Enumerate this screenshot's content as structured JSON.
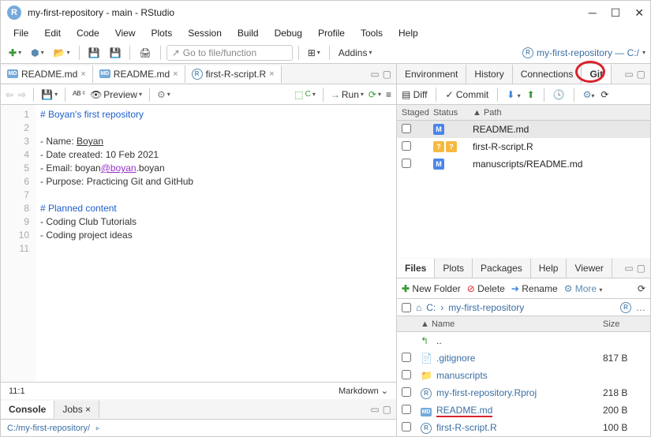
{
  "window": {
    "title": "my-first-repository - main - RStudio"
  },
  "menu": [
    "File",
    "Edit",
    "Code",
    "View",
    "Plots",
    "Session",
    "Build",
    "Debug",
    "Profile",
    "Tools",
    "Help"
  ],
  "toolbar": {
    "goto": "Go to file/function",
    "addins": "Addins",
    "project": "my-first-repository — C:/"
  },
  "source": {
    "tabs": [
      "README.md",
      "README.md",
      "first-R-script.R"
    ],
    "knit": "Preview",
    "run": "Run",
    "lines": [
      "1",
      "2",
      "3",
      "4",
      "5",
      "6",
      "7",
      "8",
      "9",
      "10",
      "11"
    ],
    "code": {
      "l1": "# Boyan's first repository",
      "l3a": "- Name: ",
      "l3b": "Boyan",
      "l4": "- Date created: 10 Feb 2021",
      "l5a": "- Email: boyan",
      "l5b": "@boyan",
      "l5c": ".boyan",
      "l6": "- Purpose: Practicing Git and GitHub",
      "l8": "# Planned content",
      "l9": "- Coding Club Tutorials",
      "l10": "- Coding project ideas"
    },
    "cursor": "11:1",
    "type": "Markdown"
  },
  "console": {
    "tabs": [
      "Console",
      "Jobs"
    ],
    "path": "C:/my-first-repository/"
  },
  "env": {
    "tabs": [
      "Environment",
      "History",
      "Connections",
      "Git"
    ],
    "diff": "Diff",
    "commit": "Commit",
    "cols": [
      "Staged",
      "Status",
      "Path"
    ],
    "rows": [
      {
        "status": [
          "M"
        ],
        "path": "README.md",
        "sel": true
      },
      {
        "status": [
          "?",
          "?"
        ],
        "path": "first-R-script.R",
        "sel": false
      },
      {
        "status": [
          "M"
        ],
        "path": "manuscripts/README.md",
        "sel": false
      }
    ]
  },
  "files": {
    "tabs": [
      "Files",
      "Plots",
      "Packages",
      "Help",
      "Viewer"
    ],
    "newfolder": "New Folder",
    "delete": "Delete",
    "rename": "Rename",
    "more": "More",
    "bc1": "C:",
    "bc2": "my-first-repository",
    "colName": "Name",
    "colSize": "Size",
    "up": "..",
    "rows": [
      {
        "icon": "file",
        "name": ".gitignore",
        "size": "817 B"
      },
      {
        "icon": "folder",
        "name": "manuscripts",
        "size": ""
      },
      {
        "icon": "rproj",
        "name": "my-first-repository.Rproj",
        "size": "218 B"
      },
      {
        "icon": "md",
        "name": "README.md",
        "size": "200 B",
        "red": true
      },
      {
        "icon": "r",
        "name": "first-R-script.R",
        "size": "100 B"
      }
    ]
  }
}
